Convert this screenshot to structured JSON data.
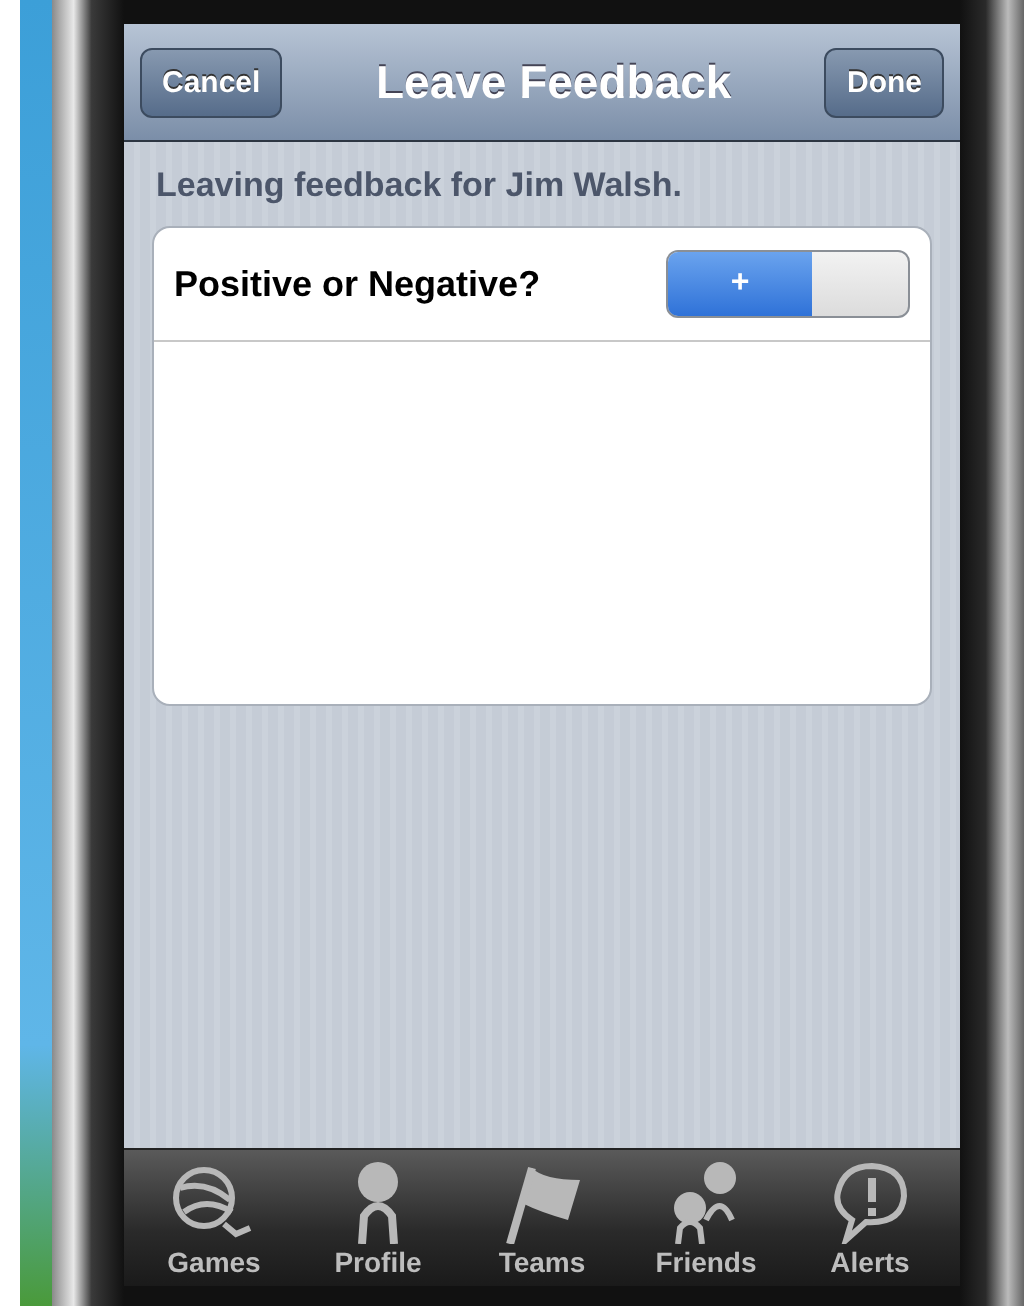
{
  "nav_bar": {
    "title": "Leave Feedback",
    "left_button": "Cancel",
    "right_button": "Done"
  },
  "subtitle": "Leaving feedback for Jim Walsh.",
  "feedback_card": {
    "label": "Positive or Negative?",
    "toggle": {
      "on": true,
      "label": "+"
    }
  },
  "tab_bar": [
    {
      "kind": "ball",
      "label": "Games"
    },
    {
      "kind": "person",
      "label": "Profile"
    },
    {
      "kind": "flag",
      "label": "Teams"
    },
    {
      "kind": "people",
      "label": "Friends"
    },
    {
      "kind": "alert",
      "label": "Alerts"
    }
  ]
}
